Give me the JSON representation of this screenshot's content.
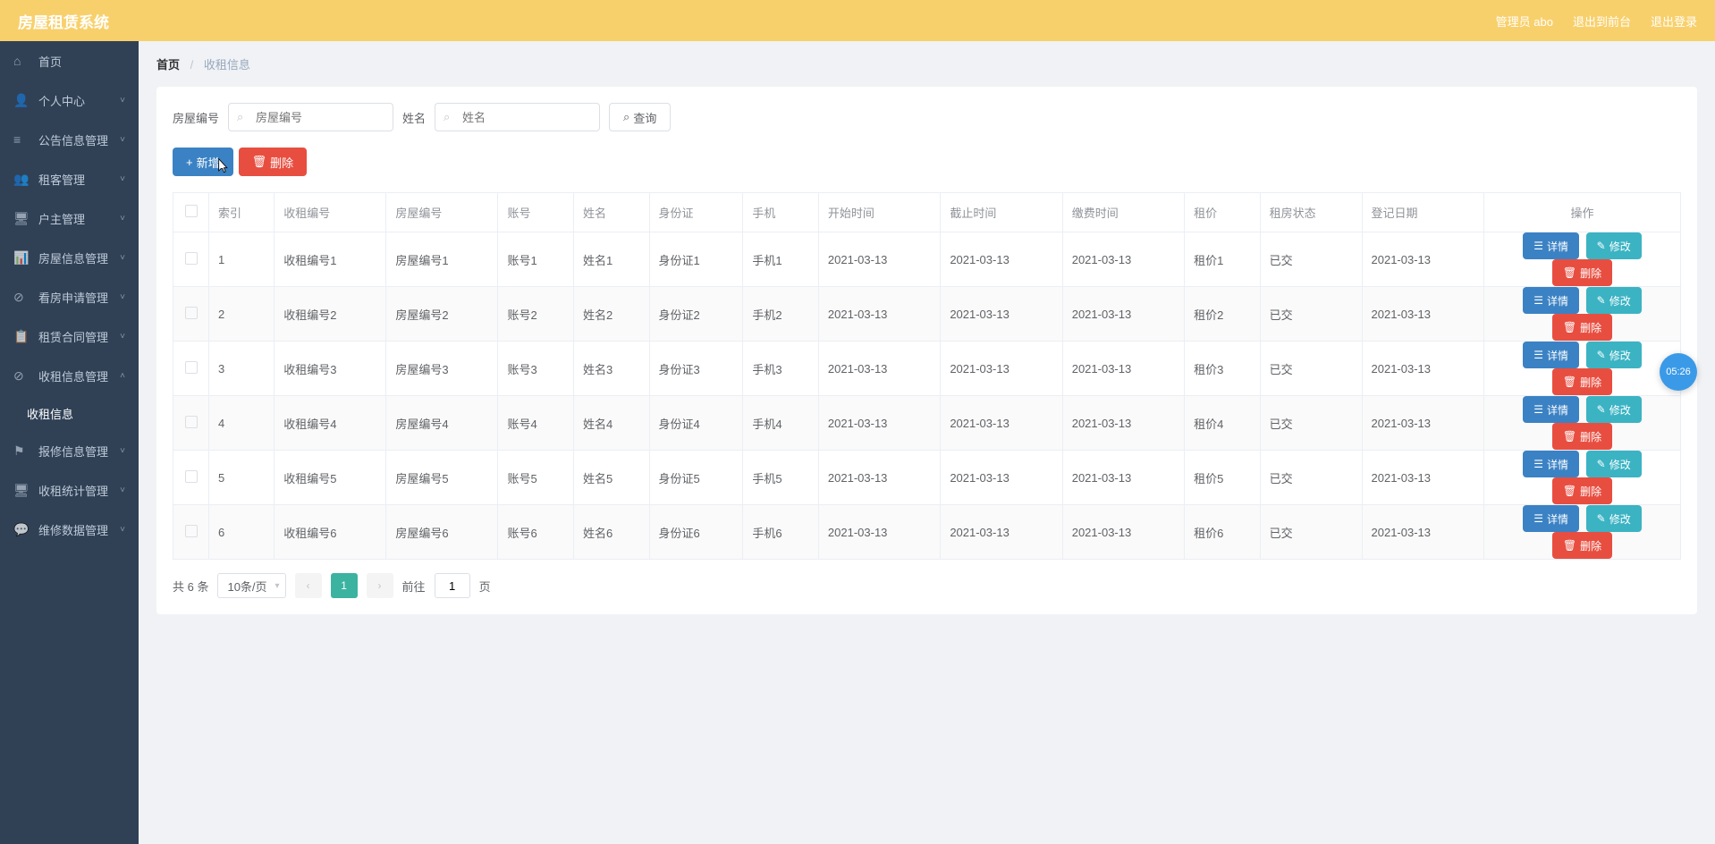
{
  "header": {
    "title": "房屋租赁系统",
    "admin_label": "管理员 abo",
    "exit_front": "退出到前台",
    "exit_login": "退出登录"
  },
  "sidebar": {
    "items": [
      {
        "icon": "⌂",
        "label": "首页",
        "has_sub": false
      },
      {
        "icon": "👤",
        "label": "个人中心",
        "has_sub": true
      },
      {
        "icon": "≡",
        "label": "公告信息管理",
        "has_sub": true
      },
      {
        "icon": "👥",
        "label": "租客管理",
        "has_sub": true
      },
      {
        "icon": "🖥",
        "label": "户主管理",
        "has_sub": true
      },
      {
        "icon": "📊",
        "label": "房屋信息管理",
        "has_sub": true
      },
      {
        "icon": "⊘",
        "label": "看房申请管理",
        "has_sub": true
      },
      {
        "icon": "📋",
        "label": "租赁合同管理",
        "has_sub": true
      },
      {
        "icon": "⊘",
        "label": "收租信息管理",
        "has_sub": true,
        "expanded": true
      },
      {
        "icon": "⚑",
        "label": "报修信息管理",
        "has_sub": true
      },
      {
        "icon": "🖥",
        "label": "收租统计管理",
        "has_sub": true
      },
      {
        "icon": "💬",
        "label": "维修数据管理",
        "has_sub": true
      }
    ],
    "submenu_label": "收租信息"
  },
  "breadcrumb": {
    "home": "首页",
    "current": "收租信息"
  },
  "search": {
    "label_house": "房屋编号",
    "placeholder_house": "房屋编号",
    "label_name": "姓名",
    "placeholder_name": "姓名",
    "query_btn": "查询"
  },
  "actions": {
    "add_btn": "新增",
    "delete_btn": "删除"
  },
  "table": {
    "headers": [
      "索引",
      "收租编号",
      "房屋编号",
      "账号",
      "姓名",
      "身份证",
      "手机",
      "开始时间",
      "截止时间",
      "缴费时间",
      "租价",
      "租房状态",
      "登记日期",
      "操作"
    ],
    "rows": [
      {
        "idx": "1",
        "rent_no": "收租编号1",
        "house_no": "房屋编号1",
        "account": "账号1",
        "name": "姓名1",
        "id_card": "身份证1",
        "phone": "手机1",
        "start": "2021-03-13",
        "end": "2021-03-13",
        "pay": "2021-03-13",
        "price": "租价1",
        "status": "已交",
        "reg_date": "2021-03-13"
      },
      {
        "idx": "2",
        "rent_no": "收租编号2",
        "house_no": "房屋编号2",
        "account": "账号2",
        "name": "姓名2",
        "id_card": "身份证2",
        "phone": "手机2",
        "start": "2021-03-13",
        "end": "2021-03-13",
        "pay": "2021-03-13",
        "price": "租价2",
        "status": "已交",
        "reg_date": "2021-03-13"
      },
      {
        "idx": "3",
        "rent_no": "收租编号3",
        "house_no": "房屋编号3",
        "account": "账号3",
        "name": "姓名3",
        "id_card": "身份证3",
        "phone": "手机3",
        "start": "2021-03-13",
        "end": "2021-03-13",
        "pay": "2021-03-13",
        "price": "租价3",
        "status": "已交",
        "reg_date": "2021-03-13"
      },
      {
        "idx": "4",
        "rent_no": "收租编号4",
        "house_no": "房屋编号4",
        "account": "账号4",
        "name": "姓名4",
        "id_card": "身份证4",
        "phone": "手机4",
        "start": "2021-03-13",
        "end": "2021-03-13",
        "pay": "2021-03-13",
        "price": "租价4",
        "status": "已交",
        "reg_date": "2021-03-13"
      },
      {
        "idx": "5",
        "rent_no": "收租编号5",
        "house_no": "房屋编号5",
        "account": "账号5",
        "name": "姓名5",
        "id_card": "身份证5",
        "phone": "手机5",
        "start": "2021-03-13",
        "end": "2021-03-13",
        "pay": "2021-03-13",
        "price": "租价5",
        "status": "已交",
        "reg_date": "2021-03-13"
      },
      {
        "idx": "6",
        "rent_no": "收租编号6",
        "house_no": "房屋编号6",
        "account": "账号6",
        "name": "姓名6",
        "id_card": "身份证6",
        "phone": "手机6",
        "start": "2021-03-13",
        "end": "2021-03-13",
        "pay": "2021-03-13",
        "price": "租价6",
        "status": "已交",
        "reg_date": "2021-03-13"
      }
    ],
    "row_actions": {
      "detail": "详情",
      "edit": "修改",
      "delete": "删除"
    }
  },
  "pagination": {
    "total_text": "共 6 条",
    "per_page": "10条/页",
    "current_page": "1",
    "goto_prefix": "前往",
    "goto_value": "1",
    "goto_suffix": "页"
  },
  "timer": "05:26"
}
